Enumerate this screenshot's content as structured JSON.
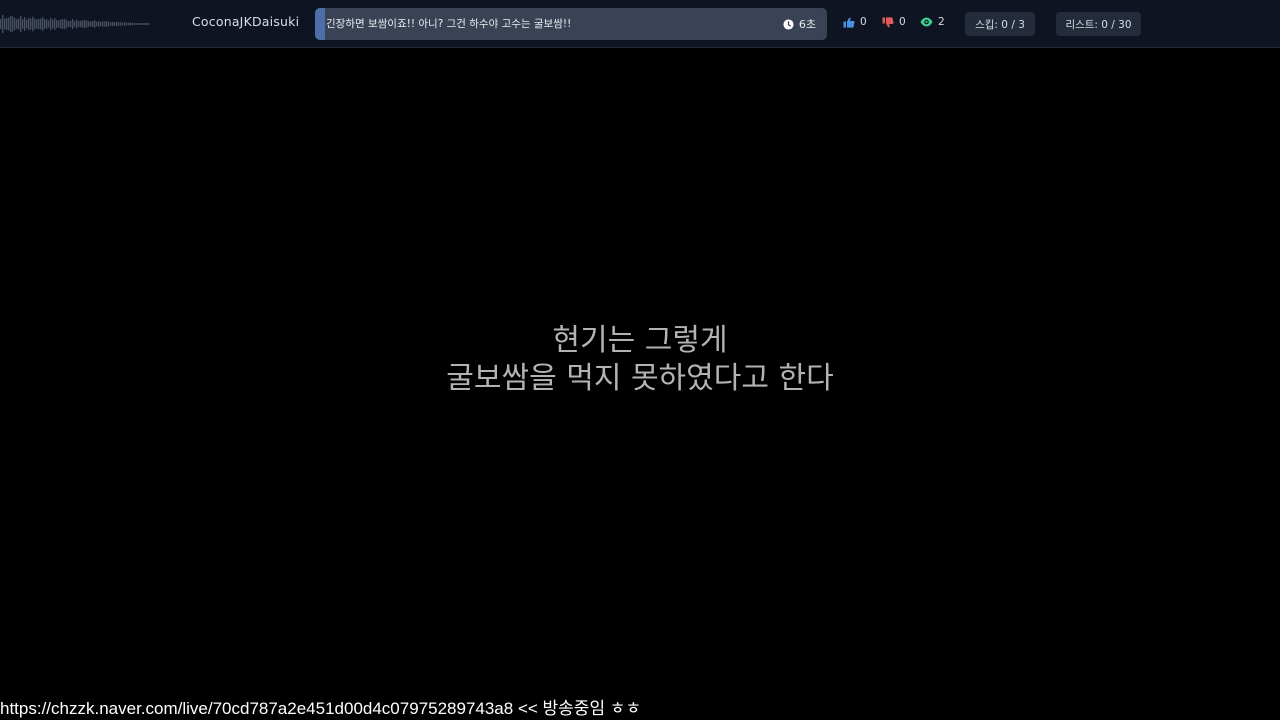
{
  "header": {
    "username": "CoconaJKDaisuki",
    "now_playing": {
      "title": "긴장하면 보쌈이죠!! 아니? 그건 하수야 고수는 굴보쌈!!",
      "time": "6초",
      "progress": 0.02
    },
    "likes": "0",
    "dislikes": "0",
    "views": "2",
    "skip": "스킵: 0 / 3",
    "list": "리스트: 0 / 30"
  },
  "lyrics": [
    "현기는 그렇게",
    "굴보쌈을 먹지 못하였다고 한다"
  ],
  "footer": {
    "text": "https://chzzk.naver.com/live/70cd787a2e451d00d4c07975289743a8 << 방송중임 ㅎㅎ"
  },
  "colors": {
    "background": "#000000",
    "topbar": "#0e1422",
    "track": "#3a4355",
    "pill": "#242c3b",
    "like": "#4a90e2",
    "dislike": "#e05a5a",
    "view": "#3ecf8e"
  },
  "icons": {
    "clock": "clock-icon",
    "like": "thumbs-up-icon",
    "dislike": "thumbs-down-icon",
    "views": "eye-icon"
  }
}
